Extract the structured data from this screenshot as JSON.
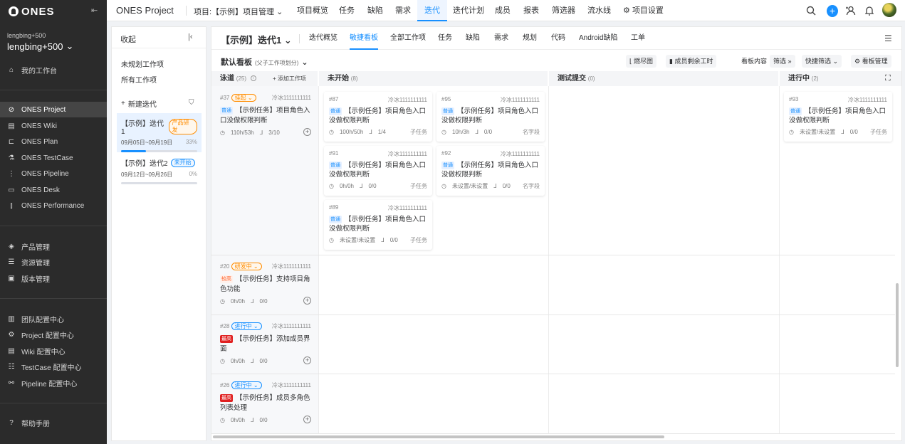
{
  "sidebar": {
    "logo": "ONES",
    "user_small": "lengbing+500",
    "user_big": "lengbing+500",
    "workbench": "我的工作台",
    "products": [
      "ONES Project",
      "ONES Wiki",
      "ONES Plan",
      "ONES TestCase",
      "ONES Pipeline",
      "ONES Desk",
      "ONES Performance"
    ],
    "manage": [
      "产品管理",
      "资源管理",
      "版本管理"
    ],
    "config": [
      "团队配置中心",
      "Project 配置中心",
      "Wiki 配置中心",
      "TestCase 配置中心",
      "Pipeline 配置中心"
    ],
    "help": "帮助手册",
    "icons": [
      "home-icon",
      "check-circle-icon",
      "doc-icon",
      "plan-icon",
      "testcase-icon",
      "pipeline-icon",
      "desk-icon",
      "performance-icon"
    ]
  },
  "topbar": {
    "title": "ONES Project",
    "project": "项目:【示例】项目管理",
    "tabs": [
      "项目概览",
      "任务",
      "缺陷",
      "需求",
      "迭代",
      "迭代计划",
      "成员",
      "报表",
      "筛选器",
      "流水线",
      "项目设置"
    ],
    "active_tab": "迭代",
    "accent": "#1890ff"
  },
  "iteration_panel": {
    "collapse_label": "收起",
    "links": [
      "未规划工作项",
      "所有工作项"
    ],
    "new_iteration": "新建迭代",
    "iterations": [
      {
        "name": "【示例】迭代1",
        "badge": "产品研发",
        "badge_color": "#ff8c00",
        "dates": "09月05日~09月19日",
        "percent": "33%",
        "progress": 0.33
      },
      {
        "name": "【示例】迭代2",
        "badge": "未开始",
        "badge_color": "#1890ff",
        "dates": "09月12日~09月26日",
        "percent": "0%",
        "progress": 0
      }
    ]
  },
  "main": {
    "iteration_title": "【示例】迭代1",
    "tabs": [
      "迭代概览",
      "敏捷看板",
      "全部工作项",
      "任务",
      "缺陷",
      "需求",
      "规划",
      "代码",
      "Android缺陷",
      "工单"
    ],
    "active_tab": "敏捷看板",
    "board_title": "默认看板",
    "board_sub": "(父子工作项划分)",
    "tools": {
      "burndown": "燃尽图",
      "remaining": "成员剩余工时",
      "content_label": "看板内容",
      "filter": "筛选",
      "quick_filter": "快捷筛选",
      "manage": "看板管理"
    },
    "columns": [
      {
        "name": "泳道",
        "count": "(25)",
        "add": "添加工作项"
      },
      {
        "name": "未开始",
        "count": "(8)"
      },
      {
        "name": "测试提交",
        "count": "(0)"
      },
      {
        "name": "进行中",
        "count": "(2)"
      }
    ],
    "parents": [
      {
        "id": "#37",
        "status": "挂起",
        "owner": "冷冰1111111111",
        "priority": "普通",
        "title": "【示例任务】项目角色入口没做权限判断",
        "hours": "110h/53h",
        "subtasks": "3/10"
      },
      {
        "id": "#20",
        "status": "研发中",
        "owner": "冷冰1111111111",
        "priority": "较高",
        "title": "【示例任务】支持项目角色功能",
        "hours": "0h/0h",
        "subtasks": "0/0"
      },
      {
        "id": "#28",
        "status": "进行中",
        "owner": "冷冰1111111111",
        "priority": "最高",
        "title": "【示例任务】添加成员界面",
        "hours": "0h/0h",
        "subtasks": "0/0"
      },
      {
        "id": "#26",
        "status": "进行中",
        "owner": "冷冰1111111111",
        "priority": "最高",
        "title": "【示例任务】成员多角色列表处理",
        "hours": "0h/0h",
        "subtasks": "0/0"
      }
    ],
    "cards": [
      {
        "id": "#87",
        "owner": "冷冰1111111111",
        "priority": "普通",
        "title": "【示例任务】项目角色入口没做权限判断",
        "hours": "100h/50h",
        "subtasks": "1/4",
        "type": "子任务"
      },
      {
        "id": "#95",
        "owner": "冷冰1111111111",
        "priority": "普通",
        "title": "【示例任务】项目角色入口没做权限判断",
        "hours": "10h/3h",
        "subtasks": "0/0",
        "type": "名字段"
      },
      {
        "id": "#91",
        "owner": "冷冰1111111111",
        "priority": "普通",
        "title": "【示例任务】项目角色入口没做权限判断",
        "hours": "0h/0h",
        "subtasks": "0/0",
        "type": "子任务"
      },
      {
        "id": "#92",
        "owner": "冷冰1111111111",
        "priority": "普通",
        "title": "【示例任务】项目角色入口没做权限判断",
        "hours": "未设置/未设置",
        "subtasks": "0/0",
        "type": "名字段"
      },
      {
        "id": "#89",
        "owner": "冷冰1111111111",
        "priority": "普通",
        "title": "【示例任务】项目角色入口没做权限判断",
        "hours": "未设置/未设置",
        "subtasks": "0/0",
        "type": "子任务"
      },
      {
        "id": "#93",
        "owner": "冷冰1111111111",
        "priority": "普通",
        "title": "【示例任务】项目角色入口没做权限判断",
        "hours": "未设置/未设置",
        "subtasks": "0/0",
        "type": "子任务"
      }
    ]
  }
}
